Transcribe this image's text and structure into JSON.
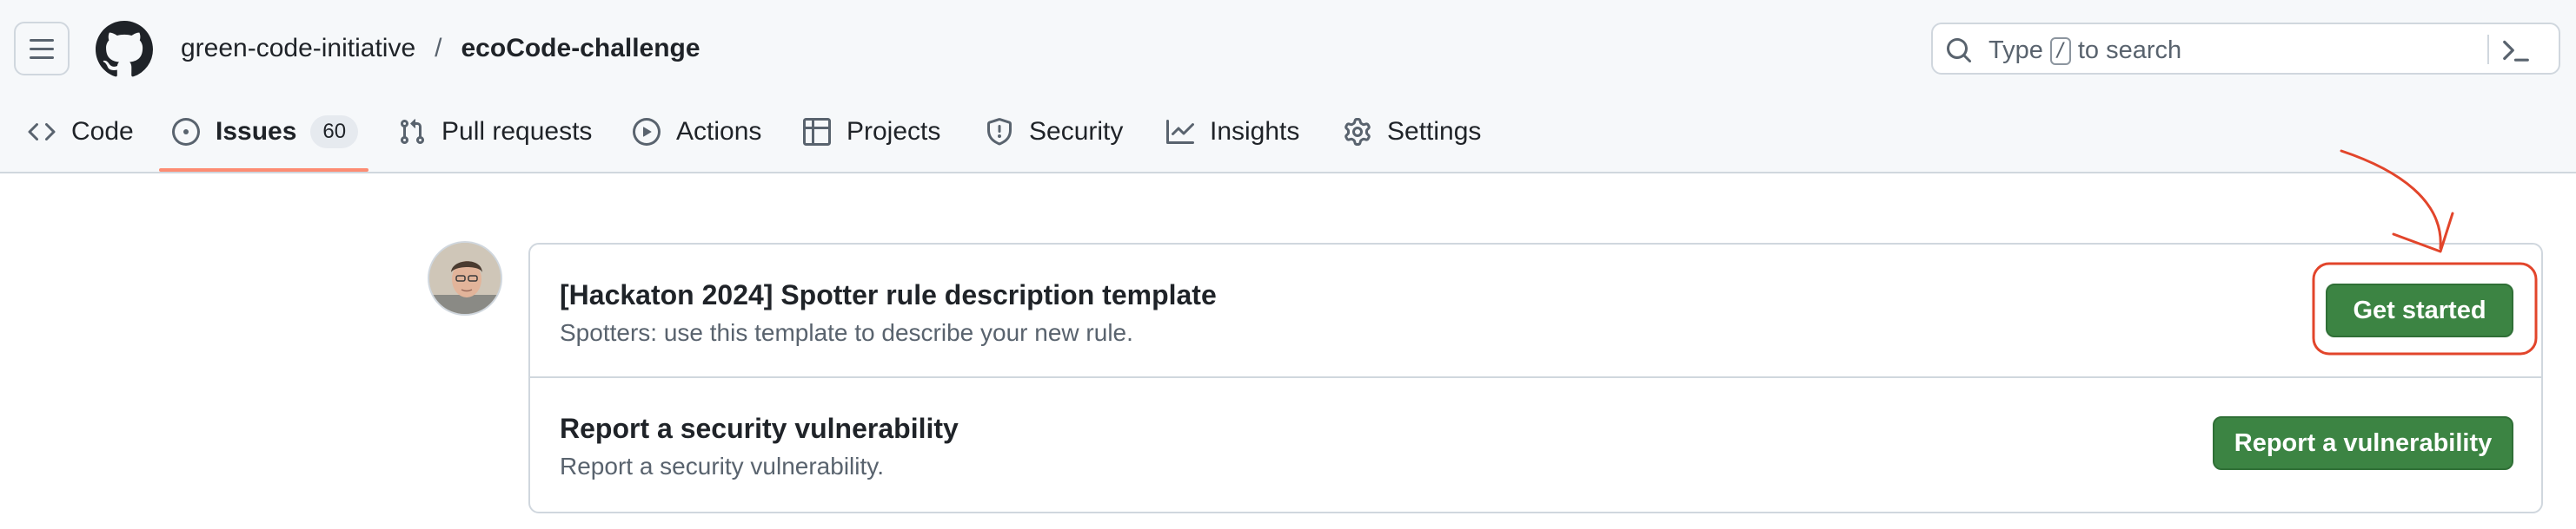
{
  "header": {
    "owner": "green-code-initiative",
    "separator": "/",
    "repo": "ecoCode-challenge",
    "search": {
      "prefix": "Type",
      "key": "/",
      "suffix": "to search"
    }
  },
  "tabs": [
    {
      "label": "Code",
      "icon": "code-icon"
    },
    {
      "label": "Issues",
      "icon": "issue-opened-icon",
      "count": "60",
      "active": true
    },
    {
      "label": "Pull requests",
      "icon": "git-pull-request-icon"
    },
    {
      "label": "Actions",
      "icon": "play-icon"
    },
    {
      "label": "Projects",
      "icon": "table-icon"
    },
    {
      "label": "Security",
      "icon": "shield-icon"
    },
    {
      "label": "Insights",
      "icon": "graph-icon"
    },
    {
      "label": "Settings",
      "icon": "gear-icon"
    }
  ],
  "templates": [
    {
      "title": "[Hackaton 2024] Spotter rule description template",
      "description": "Spotters: use this template to describe your new rule.",
      "button": "Get started"
    },
    {
      "title": "Report a security vulnerability",
      "description": "Report a security vulnerability.",
      "button": "Report a vulnerability"
    }
  ],
  "colors": {
    "accent_underline": "#fd8c73",
    "primary_button": "#3c8443",
    "annotation": "#e2452b"
  }
}
